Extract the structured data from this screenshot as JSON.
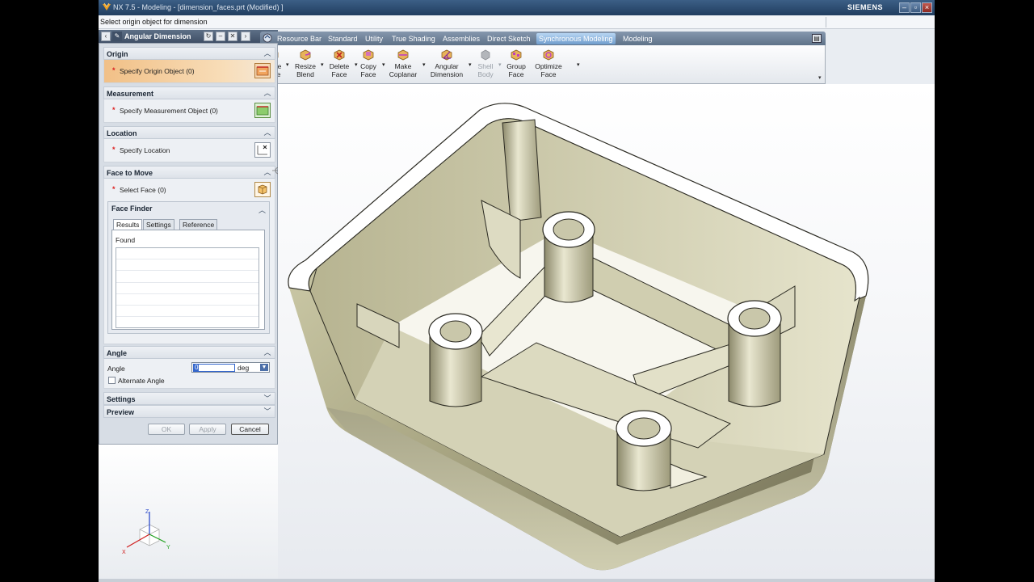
{
  "app": {
    "title": "NX 7.5 - Modeling - [dimension_faces.prt (Modified) ]",
    "brand": "SIEMENS",
    "cue": "Select origin object for dimension"
  },
  "window_controls": [
    "minimize-icon",
    "restore-icon",
    "close-icon"
  ],
  "toolbar": {
    "tabs": [
      {
        "label": "Resource Bar",
        "active": false
      },
      {
        "label": "Standard",
        "active": false
      },
      {
        "label": "Utility",
        "active": false
      },
      {
        "label": "True Shading",
        "active": false
      },
      {
        "label": "Assemblies",
        "active": false
      },
      {
        "label": "Direct Sketch",
        "active": false
      },
      {
        "label": "Synchronous Modeling",
        "active": true
      },
      {
        "label": "Modeling",
        "active": false
      }
    ],
    "buttons": [
      {
        "line1": "Move",
        "line2": "Face",
        "icon": "move-face-icon",
        "enabled": true
      },
      {
        "line1": "Resize",
        "line2": "Blend",
        "icon": "resize-blend-icon",
        "enabled": true
      },
      {
        "line1": "Delete",
        "line2": "Face",
        "icon": "delete-face-icon",
        "enabled": true
      },
      {
        "line1": "Copy",
        "line2": "Face",
        "icon": "copy-face-icon",
        "enabled": true
      },
      {
        "line1": "Make",
        "line2": "Coplanar",
        "icon": "make-coplanar-icon",
        "enabled": true
      },
      {
        "line1": "Angular",
        "line2": "Dimension",
        "icon": "angular-dimension-icon",
        "enabled": true
      },
      {
        "line1": "Shell",
        "line2": "Body",
        "icon": "shell-body-icon",
        "enabled": false
      },
      {
        "line1": "Group",
        "line2": "Face",
        "icon": "group-face-icon",
        "enabled": true
      },
      {
        "line1": "Optimize",
        "line2": "Face",
        "icon": "optimize-face-icon",
        "enabled": true
      }
    ]
  },
  "dialog": {
    "title": "Angular Dimension",
    "header_icons": [
      "back-icon",
      "pin-icon",
      "reset-icon",
      "collapse-icon",
      "close-icon",
      "forward-icon"
    ],
    "groups": {
      "origin": {
        "title": "Origin",
        "item": "Specify Origin Object (0)",
        "required": true
      },
      "measurement": {
        "title": "Measurement",
        "item": "Specify Measurement Object (0)",
        "required": true
      },
      "location": {
        "title": "Location",
        "item": "Specify Location",
        "required": true
      },
      "face_to_move": {
        "title": "Face to Move",
        "item": "Select Face (0)",
        "required": true
      }
    },
    "face_finder": {
      "title": "Face Finder",
      "tabs": [
        "Results",
        "Settings",
        "Reference"
      ],
      "active_tab": "Results",
      "found_label": "Found"
    },
    "angle": {
      "title": "Angle",
      "label": "Angle",
      "value": "0",
      "unit": "deg",
      "alternate_label": "Alternate Angle",
      "alternate_checked": false
    },
    "settings_title": "Settings",
    "preview_title": "Preview",
    "buttons": {
      "ok": "OK",
      "apply": "Apply",
      "cancel": "Cancel"
    }
  },
  "triad_axes": {
    "z": "Z",
    "x": "X",
    "y": "Y"
  },
  "colors": {
    "title_bar": "#2a4868",
    "active_tab": "#8ab4e0",
    "active_row": "#f3c98f",
    "part_shade": "#bdb995",
    "part_light": "#f2f0de",
    "axis_x": "#d02020",
    "axis_y": "#1fa01f",
    "axis_z": "#1f3fc8"
  }
}
